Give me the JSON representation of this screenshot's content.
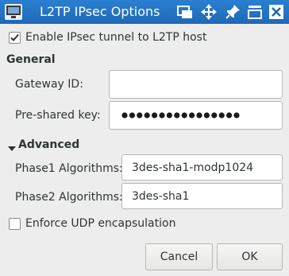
{
  "window": {
    "title": "L2TP IPsec Options",
    "app_icon": "network-icon",
    "titlebar_buttons": [
      "window-stack-icon",
      "move-icon",
      "pin-icon",
      "minimize-icon",
      "close-icon"
    ],
    "titlebar_color": "#1f6fc5"
  },
  "ipsec": {
    "enable_label": "Enable IPsec tunnel to L2TP host",
    "enable_checked": true
  },
  "general": {
    "heading": "General",
    "gateway_label": "Gateway ID:",
    "gateway_value": "",
    "psk_label": "Pre-shared key:",
    "psk_masked_count": 16
  },
  "advanced": {
    "heading": "Advanced",
    "expanded": true,
    "phase1_label": "Phase1 Algorithms:",
    "phase1_value": "3des-sha1-modp1024",
    "phase2_label": "Phase2 Algorithms:",
    "phase2_value": "3des-sha1"
  },
  "encap": {
    "label": "Enforce UDP encapsulation",
    "checked": false
  },
  "buttons": {
    "cancel": "Cancel",
    "ok": "OK"
  }
}
